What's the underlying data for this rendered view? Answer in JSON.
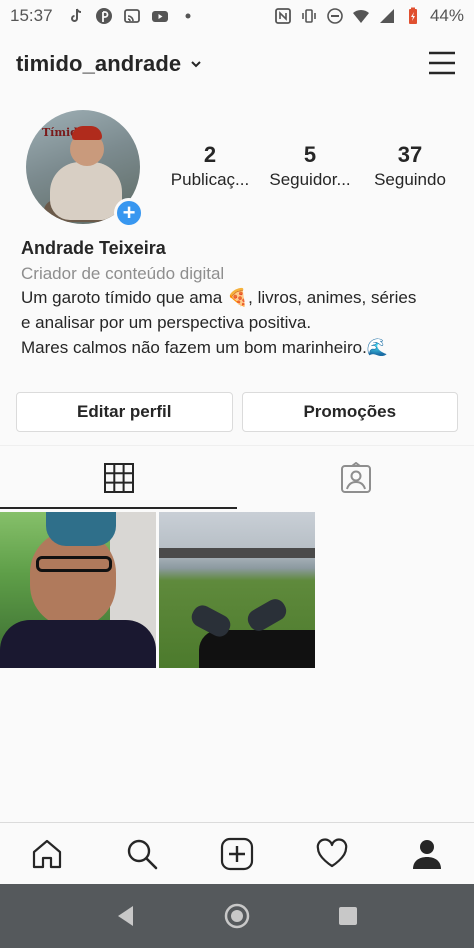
{
  "status_bar": {
    "time": "15:37",
    "battery": "44%",
    "left_icons": [
      "tiktok-icon",
      "pinterest-icon",
      "cast-icon",
      "youtube-icon",
      "dot-icon"
    ],
    "right_icons": [
      "nfc-icon",
      "vibrate-icon",
      "dnd-icon",
      "wifi-icon",
      "signal-icon",
      "battery-icon"
    ]
  },
  "header": {
    "username": "timido_andrade"
  },
  "profile": {
    "avatar_word": "Tímido",
    "stats": [
      {
        "value": "2",
        "label": "Publicaç..."
      },
      {
        "value": "5",
        "label": "Seguidor..."
      },
      {
        "value": "37",
        "label": "Seguindo"
      }
    ],
    "name": "Andrade Teixeira",
    "category": "Criador de conteúdo digital",
    "bio_line1_a": "Um garoto tímido que ama ",
    "bio_emoji1": "🍕",
    "bio_line1_b": ", livros, animes, séries",
    "bio_line2": "e analisar por um perspectiva positiva.",
    "bio_line3": "Mares calmos não fazem um bom marinheiro.",
    "bio_emoji2": "🌊"
  },
  "buttons": {
    "edit_profile": "Editar perfil",
    "promotions": "Promoções"
  },
  "colors": {
    "accent": "#3897f0",
    "text": "#262626",
    "muted": "#8e8e8e",
    "android_nav": "#55595c"
  }
}
